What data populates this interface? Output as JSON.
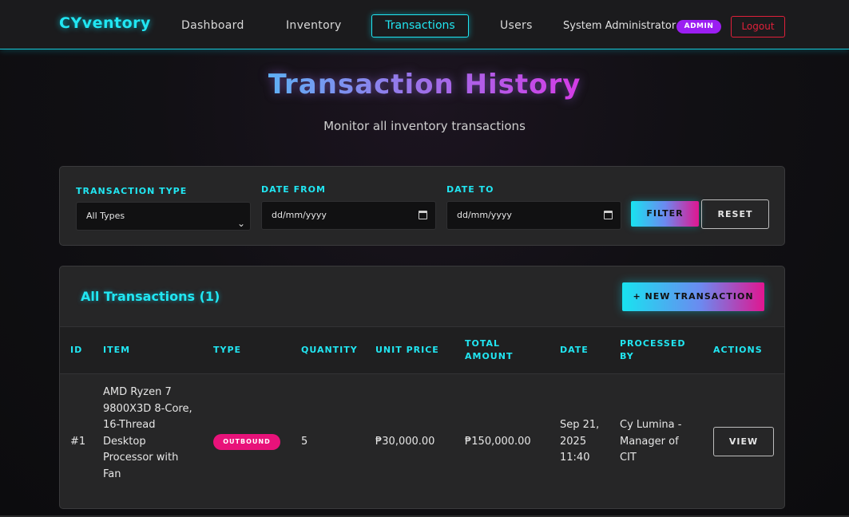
{
  "nav": {
    "brand": "CYventory",
    "links": [
      "Dashboard",
      "Inventory",
      "Transactions",
      "Users"
    ],
    "active": "Transactions",
    "user_name": "System Administrator",
    "role": "ADMIN",
    "logout": "Logout"
  },
  "page": {
    "title": "Transaction History",
    "subtitle": "Monitor all inventory transactions"
  },
  "filters": {
    "type_label": "TRANSACTION TYPE",
    "type_value": "All Types",
    "date_from_label": "DATE FROM",
    "date_from_placeholder": "dd/mm/yyyy",
    "date_to_label": "DATE TO",
    "date_to_placeholder": "dd/mm/yyyy",
    "filter_button": "FILTER",
    "reset_button": "RESET"
  },
  "transactions": {
    "title": "All Transactions (1)",
    "new_button": "+ NEW TRANSACTION",
    "columns": [
      "ID",
      "ITEM",
      "TYPE",
      "QUANTITY",
      "UNIT PRICE",
      "TOTAL AMOUNT",
      "DATE",
      "PROCESSED BY",
      "ACTIONS"
    ],
    "rows": [
      {
        "id": "#1",
        "item": "AMD Ryzen 7 9800X3D 8-Core, 16-Thread Desktop Processor with Fan",
        "type": "OUTBOUND",
        "quantity": "5",
        "unit_price": "₱30,000.00",
        "total_amount": "₱150,000.00",
        "date": "Sep 21, 2025 11:40",
        "processed_by": "Cy Lumina - Manager of CIT",
        "action": "VIEW"
      }
    ]
  },
  "colors": {
    "accent": "#21e6f2",
    "magenta": "#e8127a",
    "purple": "#9b1ef2",
    "danger": "#e0203a"
  }
}
